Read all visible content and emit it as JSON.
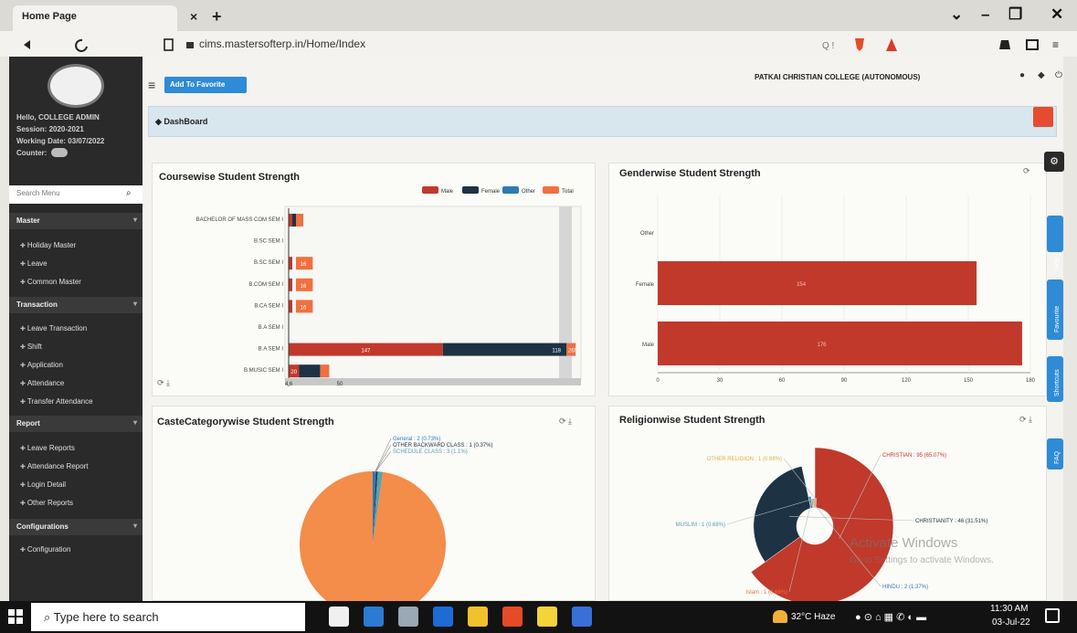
{
  "browser": {
    "tab_title": "Home Page",
    "tab_close": "×",
    "tab_new": "+",
    "url": "cims.mastersofterp.in/Home/Index",
    "win_chevron": "⌄",
    "win_min": "–",
    "win_max": "❐",
    "win_close": "✕"
  },
  "sidebar": {
    "user_lines": [
      "Hello, COLLEGE ADMIN",
      "Session: 2020-2021",
      "Working Date: 03/07/2022",
      "Counter:"
    ],
    "search_placeholder": "Search Menu",
    "sections": [
      {
        "title": "Master",
        "items": [
          "Holiday Master",
          "Leave",
          "Common Master"
        ]
      },
      {
        "title": "Transaction",
        "items": [
          "Leave Transaction",
          "Shift",
          "Application",
          "Attendance",
          "Transfer Attendance"
        ]
      },
      {
        "title": "Report",
        "items": [
          "Leave Reports",
          "Attendance Report",
          "Login Detail",
          "Other Reports"
        ]
      },
      {
        "title": "Configurations",
        "items": [
          "Configuration"
        ]
      }
    ]
  },
  "header": {
    "fav_button": "Add To Favorite",
    "college": "PATKAI CHRISTIAN COLLEGE (AUTONOMOUS)",
    "dashboard_label": "DashBoard"
  },
  "side_tabs": [
    "Help",
    "Favourite",
    "Shortcuts",
    "FAQ"
  ],
  "watermark": {
    "title": "Activate Windows",
    "sub": "Go to Settings to activate Windows."
  },
  "chart_data": [
    {
      "type": "bar",
      "title": "Coursewise Student Strength",
      "orientation": "horizontal",
      "stacked": true,
      "categories": [
        "BACHELOR OF MASS COM SEM I",
        "B.SC SEM I",
        "B.SC SEM I",
        "B.COM SEM I",
        "B.CA SEM I",
        "B.A SEM I",
        "B.A SEM I",
        "B.MUSIC SEM I"
      ],
      "series": [
        {
          "name": "Male",
          "color": "#c0392b",
          "values": [
            1,
            0,
            2,
            2,
            2,
            0,
            147,
            10
          ]
        },
        {
          "name": "Female",
          "color": "#1d3344",
          "values": [
            2,
            0,
            0,
            0,
            0,
            0,
            118,
            20
          ]
        },
        {
          "name": "Other",
          "color": "#2b7bb9",
          "values": [
            0,
            0,
            0,
            0,
            0,
            0,
            0,
            0
          ]
        },
        {
          "name": "Total",
          "color": "#f07040",
          "values": [
            3,
            0,
            16,
            16,
            16,
            0,
            265,
            30
          ]
        }
      ],
      "bar_labels": [
        "",
        "",
        "16",
        "16",
        "16",
        "",
        "147",
        "20"
      ],
      "end_labels": [
        "",
        "",
        "",
        "",
        "",
        "",
        "265",
        ""
      ],
      "dark_labels": [
        "",
        "",
        "",
        "",
        "",
        "",
        "118",
        ""
      ],
      "xticks": [
        "4.6",
        "50"
      ],
      "legend": "top-right"
    },
    {
      "type": "bar",
      "title": "Genderwise Student Strength",
      "orientation": "horizontal",
      "categories": [
        "Other",
        "Female",
        "Male"
      ],
      "series": [
        {
          "name": "",
          "color": "#c0392b",
          "values": [
            0,
            154,
            176
          ]
        }
      ],
      "bar_labels": [
        "",
        "154",
        "176"
      ],
      "xlim": [
        0,
        180
      ],
      "xticks": [
        "0",
        "30",
        "60",
        "90",
        "120",
        "150",
        "180"
      ]
    },
    {
      "type": "pie",
      "title": "CasteCategorywise Student Strength",
      "slices": [
        {
          "label": "General : 2 (0.73%)",
          "value": 2,
          "color": "#2b7bb9"
        },
        {
          "label": "OTHER BACKWARD CLASS : 1 (0.37%)",
          "value": 1,
          "color": "#1d3344"
        },
        {
          "label": "SCHEDULE CLASS : 3 (1.1%)",
          "value": 3,
          "color": "#5aa0b0"
        },
        {
          "label": "",
          "value": 266,
          "color": "#f48c4a"
        }
      ]
    },
    {
      "type": "pie",
      "title": "Religionwise Student Strength",
      "variant": "nightingale-rose",
      "slices": [
        {
          "label": "CHRISTIAN : 95 (65.07%)",
          "value": 95,
          "color": "#c0392b"
        },
        {
          "label": "CHRISTIANITY : 46 (31.51%)",
          "value": 46,
          "color": "#1d3344"
        },
        {
          "label": "HINDU : 2 (1.37%)",
          "value": 2,
          "color": "#2b7bb9"
        },
        {
          "label": "Islam : 1 (0.68%)",
          "value": 1,
          "color": "#f07040"
        },
        {
          "label": "MUSLIM : 1 (0.68%)",
          "value": 1,
          "color": "#5aa0b0"
        },
        {
          "label": "OTHER RELIGION : 1 (0.68%)",
          "value": 1,
          "color": "#e2b04a"
        }
      ]
    }
  ],
  "taskbar": {
    "search": "Type here to search",
    "weather": "32°C  Haze",
    "time": "11:30 AM",
    "date": "03-Jul-22"
  }
}
